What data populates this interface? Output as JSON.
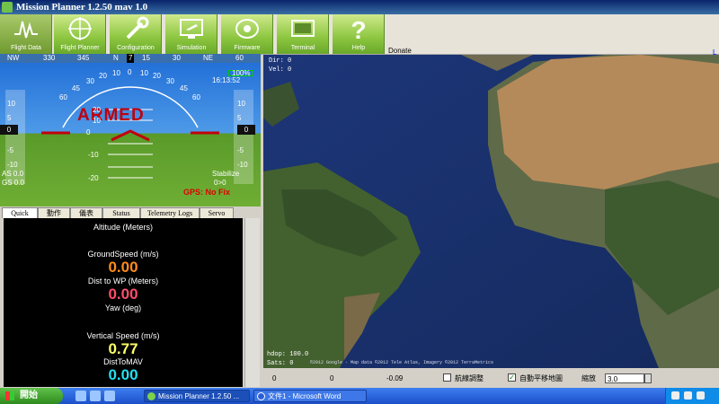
{
  "window": {
    "title": "Mission Planner 1.2.50 mav 1.0"
  },
  "toolbar": {
    "buttons": [
      {
        "label": "Flight Data",
        "icon": "flight-data-icon"
      },
      {
        "label": "Flight Planner",
        "icon": "flight-planner-icon"
      },
      {
        "label": "Configuration",
        "icon": "configuration-icon"
      },
      {
        "label": "Simulation",
        "icon": "simulation-icon"
      },
      {
        "label": "Firmware",
        "icon": "firmware-icon"
      },
      {
        "label": "Terminal",
        "icon": "terminal-icon"
      },
      {
        "label": "Help",
        "icon": "help-icon"
      }
    ],
    "donate": "Donate"
  },
  "hud": {
    "compass": [
      "NW",
      "330",
      "345",
      "N",
      "15",
      "30",
      "NE",
      "60"
    ],
    "heading": "7",
    "status": "ARMED",
    "mode": "Stabilize",
    "wp": "0>0",
    "battery": "100%",
    "time": "16:13:52",
    "as": "AS 0.0",
    "gs": "GS 0.0",
    "gps": "GPS: No Fix",
    "speed_pointer": "0",
    "alt_pointer": "0",
    "left_scale": [
      "10",
      "5",
      "-5",
      "-10"
    ],
    "right_scale": [
      "10",
      "5",
      "-5",
      "-10"
    ],
    "pitch": [
      "20",
      "10",
      "0",
      "-10",
      "-20"
    ],
    "roll": [
      "60",
      "45",
      "30",
      "20",
      "10",
      "0",
      "10",
      "20",
      "30",
      "45",
      "60"
    ]
  },
  "tabs": [
    "Quick",
    "動作",
    "儀表",
    "Status",
    "Telemetry Logs",
    "Servo"
  ],
  "quick": [
    {
      "label": "Altitude (Meters)",
      "value": "",
      "color": "#ffffff"
    },
    {
      "label": "GroundSpeed (m/s)",
      "value": "0.00",
      "color": "#ff8c1a"
    },
    {
      "label": "Dist to WP (Meters)",
      "value": "0.00",
      "color": "#ff4d6d"
    },
    {
      "label": "Yaw (deg)",
      "value": "",
      "color": "#ffffff"
    },
    {
      "label": "Vertical Speed (m/s)",
      "value": "0.77",
      "color": "#ffff66"
    },
    {
      "label": "DistToMAV",
      "value": "0.00",
      "color": "#22e0f0"
    }
  ],
  "map": {
    "dir": "Dir: 0",
    "vel": "Vel: 0",
    "hdop": "hdop: 100.0",
    "sats": "Sats: 0",
    "copyright": "©2012 Google - Map data ©2012 Tele Atlas, Imagery ©2012 TerraMetrics",
    "bottom": {
      "v1": "0",
      "v2": "0",
      "v3": "-0.09",
      "autopan_label": "自動平移地圖",
      "autopan_checked": true,
      "tune_label": "航線調整",
      "tune_checked": false,
      "zoom_label": "縮放",
      "zoom_value": "3.0"
    }
  },
  "taskbar": {
    "start": "開始",
    "tasks": [
      "Mission Planner 1.2.50 ...",
      "文件1 - Microsoft Word"
    ]
  }
}
